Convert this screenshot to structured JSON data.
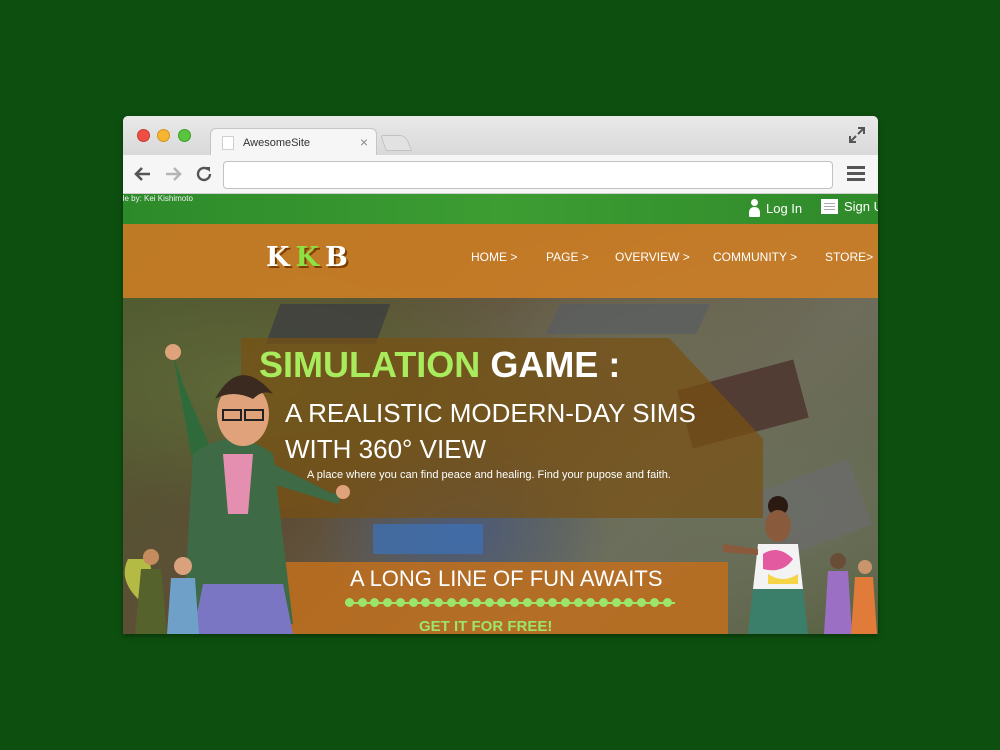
{
  "browser": {
    "tab_title": "AwesomeSite",
    "tab_close": "×",
    "url": ""
  },
  "site": {
    "credit": "de by: Kei Kishimoto",
    "login_label": "Log In",
    "signup_label": "Sign Up",
    "logo": {
      "k1": "K",
      "k2": "K",
      "b": "B"
    },
    "nav": [
      "HOME >",
      "PAGE >",
      "OVERVIEW >",
      "COMMUNITY >",
      "STORE>"
    ],
    "hero": {
      "title_green": "SIMULATION",
      "title_white": " GAME :",
      "subtitle_1": "A REALISTIC MODERN-DAY SIMS",
      "subtitle_2": "WITH 360° VIEW",
      "description": "A place where you can find peace and healing. Find your pupose and faith."
    },
    "cta": {
      "line": "A LONG LINE OF FUN AWAITS",
      "free": "GET IT FOR FREE!"
    }
  },
  "colors": {
    "page_bg": "#0d4f0f",
    "topbar_green": "#3d9d33",
    "nav_orange": "#d38023",
    "accent_green": "#a8ec5d"
  },
  "icons": [
    "expand-icon",
    "back-arrow-icon",
    "forward-arrow-icon",
    "reload-icon",
    "menu-icon",
    "person-icon",
    "document-icon"
  ]
}
